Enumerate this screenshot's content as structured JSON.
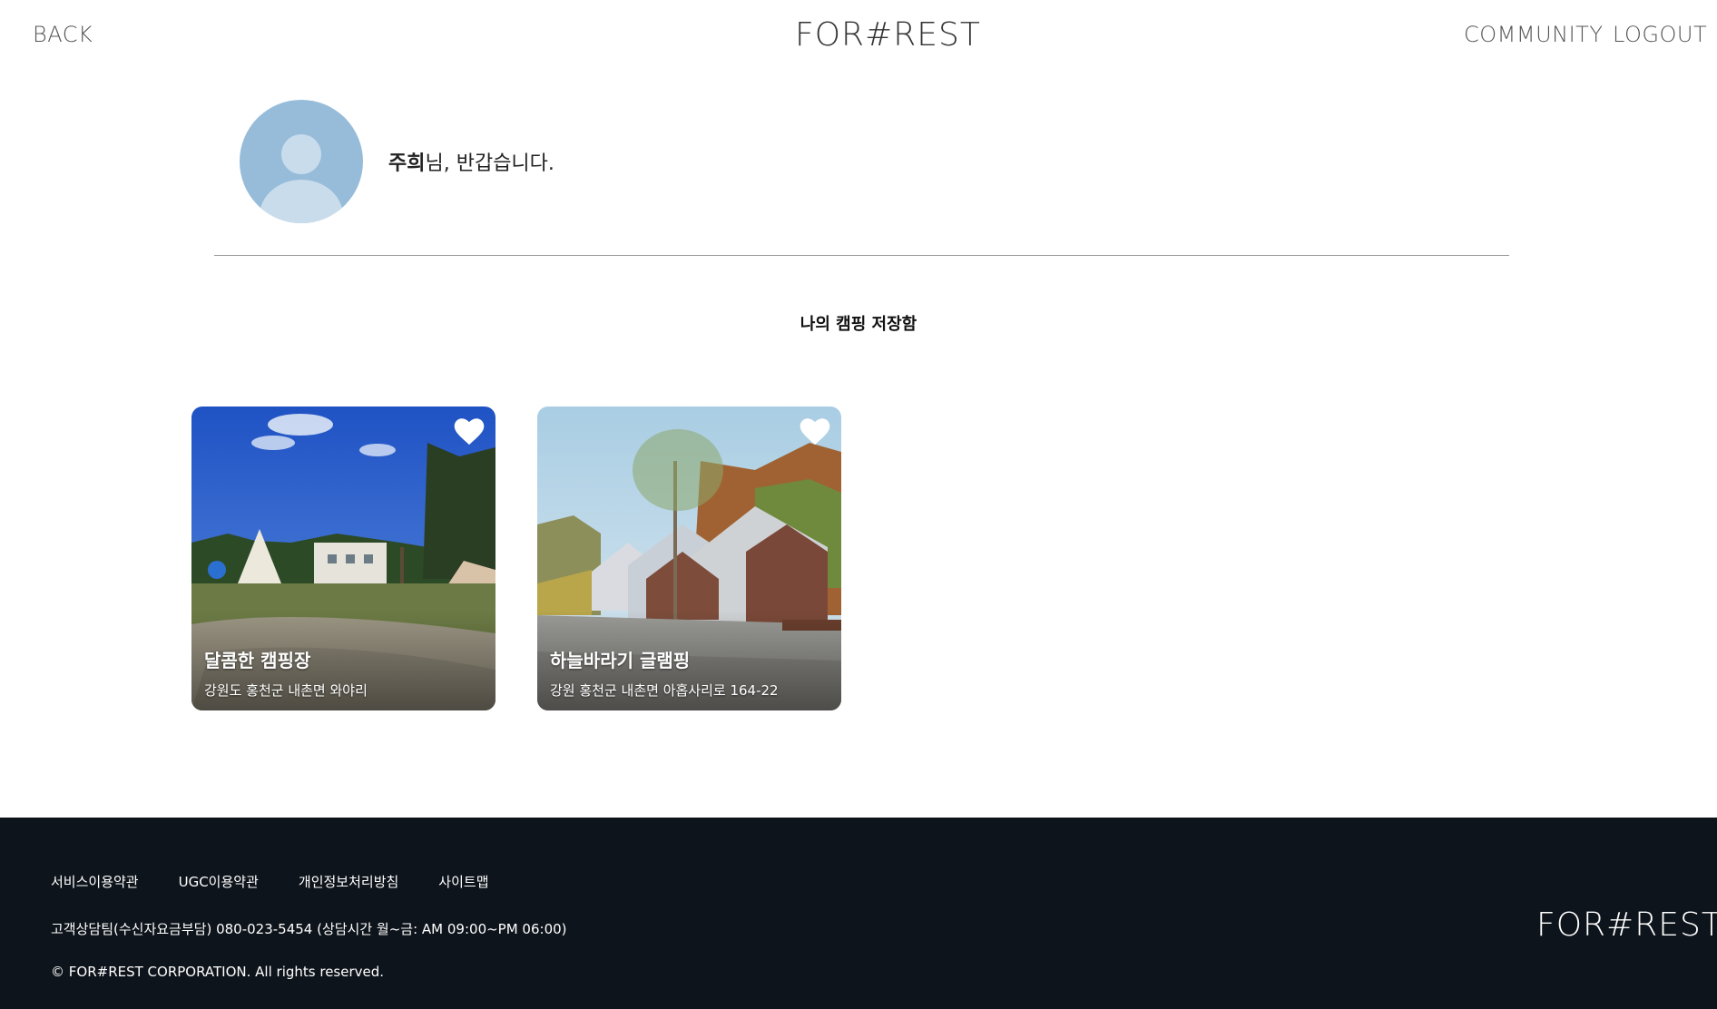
{
  "header": {
    "back_label": "BACK",
    "logo": "FOR#REST",
    "community_label": "COMMUNITY",
    "logout_label": "LOGOUT"
  },
  "profile": {
    "name": "주희",
    "greeting_suffix": "님, 반갑습니다."
  },
  "section_title": "나의 캠핑 저장함",
  "cards": [
    {
      "title": "달콤한 캠핑장",
      "address": "강원도 홍천군 내촌면 와야리",
      "heart_icon": "heart-icon"
    },
    {
      "title": "하늘바라기 글램핑",
      "address": "강원 홍천군 내촌면 아홉사리로 164-22",
      "heart_icon": "heart-icon"
    }
  ],
  "footer": {
    "links": [
      "서비스이용약관",
      "UGC이용약관",
      "개인정보처리방침",
      "사이트맵"
    ],
    "contact": "고객상담팀(수신자요금부담) 080-023-5454 (상담시간 월~금: AM 09:00~PM 06:00)",
    "copyright": "© FOR#REST CORPORATION. All rights reserved.",
    "logo": "FOR#REST"
  }
}
